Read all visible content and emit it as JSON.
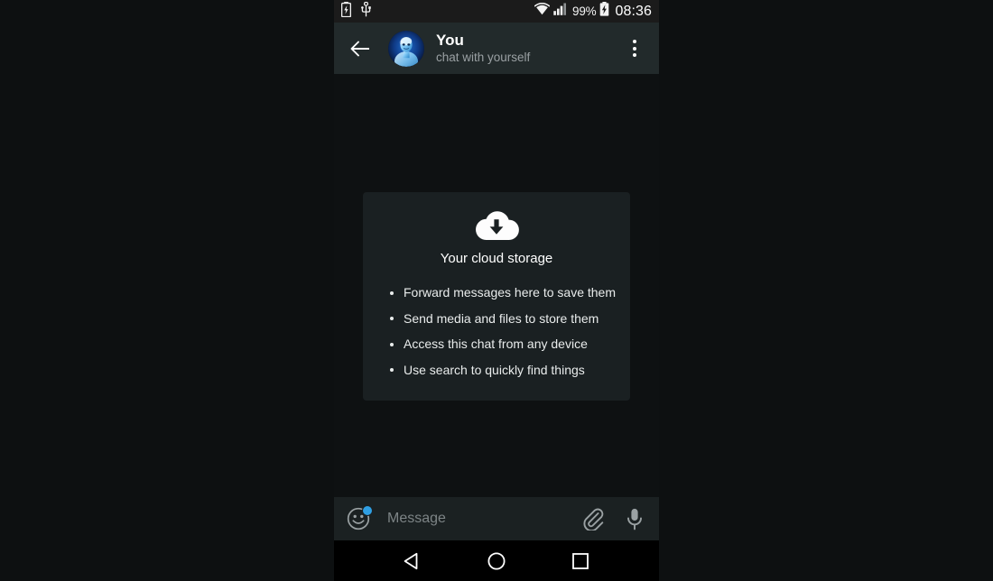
{
  "status_bar": {
    "left_icons": [
      "battery-charging-icon",
      "usb-icon"
    ],
    "right_icons": [
      "wifi-icon",
      "cellular-signal-icon",
      "battery-charging-icon"
    ],
    "battery_percent": "99%",
    "clock": "08:36"
  },
  "app_bar": {
    "back_icon": "back-arrow-icon",
    "avatar_alt": "avatar",
    "title": "You",
    "subtitle": "chat with yourself",
    "overflow_icon": "more-vertical-icon"
  },
  "cloud_card": {
    "icon": "cloud-download-icon",
    "title": "Your cloud storage",
    "bullets": [
      "Forward messages here to save them",
      "Send media and files to store them",
      "Access this chat from any device",
      "Use search to quickly find things"
    ]
  },
  "input_bar": {
    "emoji_icon": "emoji-smiley-icon",
    "has_emoji_badge": true,
    "badge_color": "#2f9fe3",
    "message_value": "",
    "message_placeholder": "Message",
    "attach_icon": "paperclip-icon",
    "mic_icon": "microphone-icon"
  },
  "nav_bar": {
    "back_icon": "nav-back-triangle-icon",
    "home_icon": "nav-home-circle-icon",
    "recents_icon": "nav-recents-square-icon"
  },
  "colors": {
    "page_background": "#0d1011",
    "status_bar": "#1b1b1b",
    "app_bar": "#222a2b",
    "chat_background": "#0e1112",
    "card_background": "#1a2022",
    "input_bar": "#1b2122",
    "nav_bar": "#000000",
    "accent": "#2f9fe3",
    "primary_text": "#ffffff",
    "secondary_text": "#9aa0a3"
  }
}
